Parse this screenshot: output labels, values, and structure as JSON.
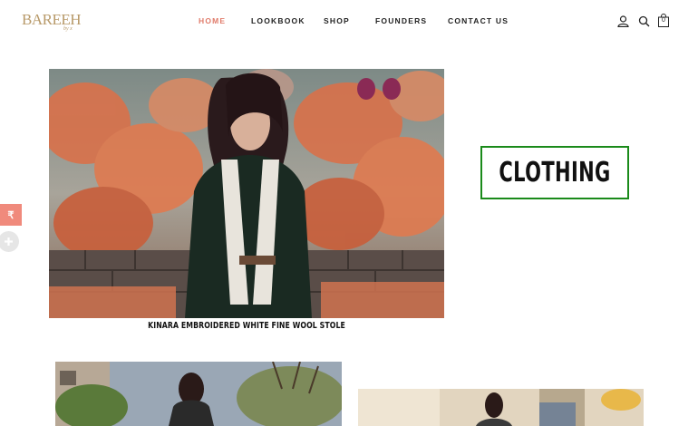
{
  "brand": {
    "logo_text": "BAREEH",
    "logo_sub": "by x"
  },
  "nav": {
    "items": [
      {
        "label": "HOME",
        "active": true
      },
      {
        "label": "LOOKBOOK",
        "active": false
      },
      {
        "label": "SHOP",
        "active": false
      },
      {
        "label": "FOUNDERS",
        "active": false
      },
      {
        "label": "CONTACT US",
        "active": false
      }
    ]
  },
  "header_icons": {
    "account": "user-icon",
    "search": "search-icon",
    "cart": "bag-icon",
    "cart_count": "0"
  },
  "hero": {
    "caption": "KINARA EMBROIDERED WHITE FINE WOOL STOLE",
    "category_label": "CLOTHING"
  },
  "side_widgets": {
    "currency_symbol": "₹",
    "plus_icon": "plus-icon"
  },
  "colors": {
    "accent": "#e07b6a",
    "category_border": "#1a8a1a",
    "logo": "#b89a6a",
    "currency_tab": "#f08a7c"
  }
}
